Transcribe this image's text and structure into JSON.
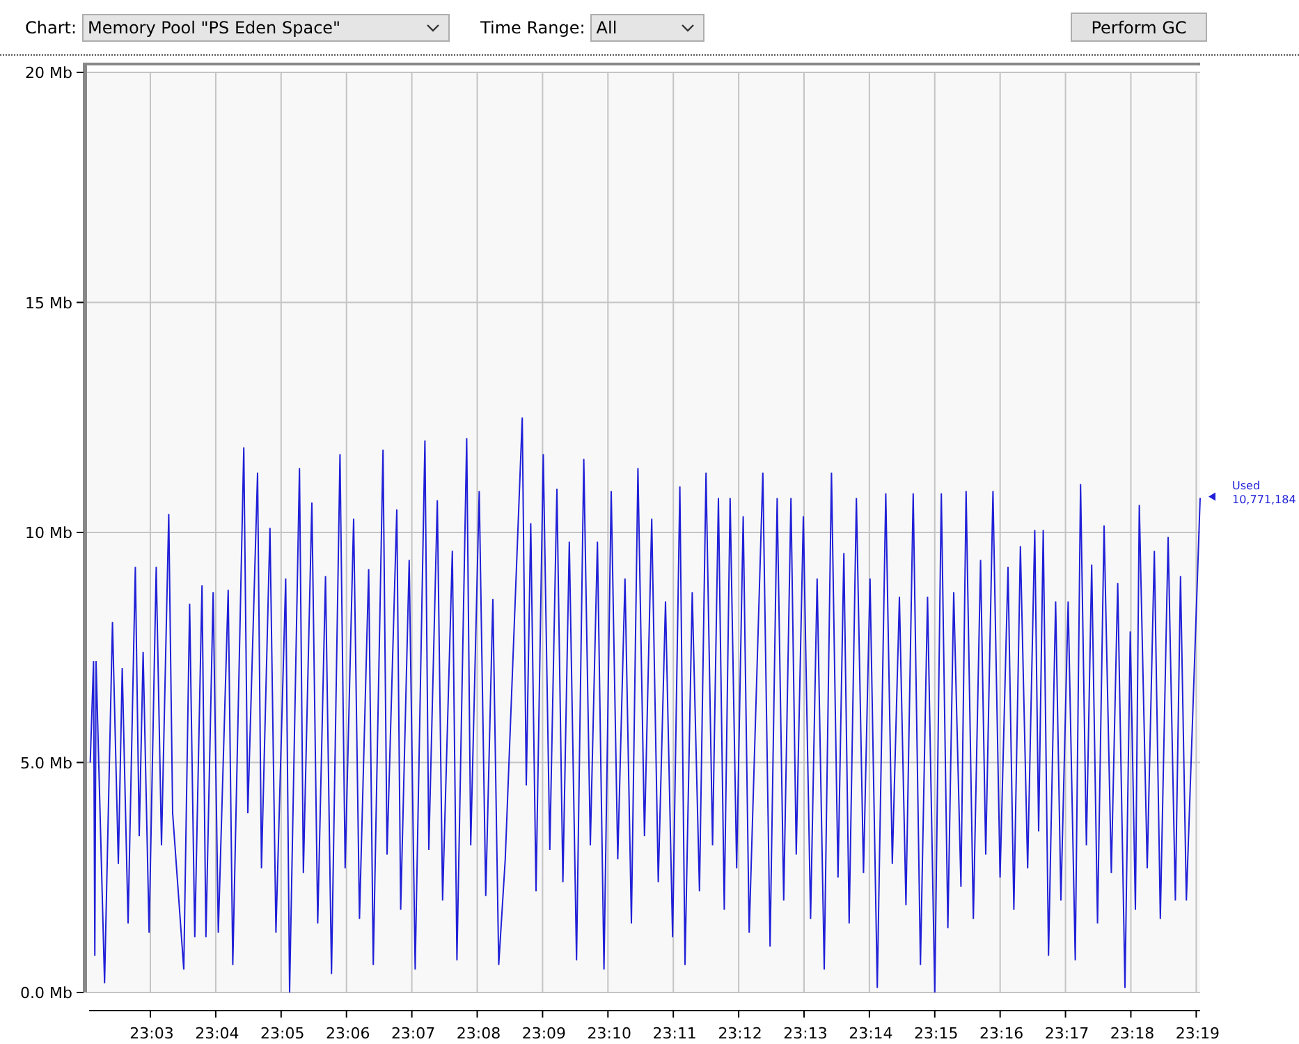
{
  "toolbar": {
    "chart_label": "Chart:",
    "chart_select": "Memory Pool \"PS Eden Space\"",
    "time_range_label": "Time Range:",
    "time_range_select": "All",
    "perform_gc": "Perform GC"
  },
  "memory_chart": {
    "current_value": "10,771,184",
    "chart_data": {
      "type": "line",
      "grid": true,
      "xlim": [
        1382.02,
        1399.06
      ],
      "ylim": [
        0,
        20
      ],
      "yticks": [
        {
          "value": 0,
          "label": "0.0 Mb"
        },
        {
          "value": 5,
          "label": "5.0 Mb"
        },
        {
          "value": 10,
          "label": "10 Mb"
        },
        {
          "value": 15,
          "label": "15 Mb"
        },
        {
          "value": 20,
          "label": "20 Mb"
        }
      ],
      "xticks": [
        {
          "value": 1383,
          "label": "23:03"
        },
        {
          "value": 1384,
          "label": "23:04"
        },
        {
          "value": 1385,
          "label": "23:05"
        },
        {
          "value": 1386,
          "label": "23:06"
        },
        {
          "value": 1387,
          "label": "23:07"
        },
        {
          "value": 1388,
          "label": "23:08"
        },
        {
          "value": 1389,
          "label": "23:09"
        },
        {
          "value": 1390,
          "label": "23:10"
        },
        {
          "value": 1391,
          "label": "23:11"
        },
        {
          "value": 1392,
          "label": "23:12"
        },
        {
          "value": 1393,
          "label": "23:13"
        },
        {
          "value": 1394,
          "label": "23:14"
        },
        {
          "value": 1395,
          "label": "23:15"
        },
        {
          "value": 1396,
          "label": "23:16"
        },
        {
          "value": 1397,
          "label": "23:17"
        },
        {
          "value": 1398,
          "label": "23:18"
        },
        {
          "value": 1399,
          "label": "23:19"
        }
      ],
      "x": [
        1382.08,
        1382.13,
        1382.15,
        1382.17,
        1382.3,
        1382.42,
        1382.51,
        1382.57,
        1382.66,
        1382.77,
        1382.83,
        1382.89,
        1382.98,
        1383.09,
        1383.17,
        1383.28,
        1383.34,
        1383.51,
        1383.6,
        1383.68,
        1383.79,
        1383.85,
        1383.96,
        1384.04,
        1384.19,
        1384.26,
        1384.43,
        1384.49,
        1384.64,
        1384.7,
        1384.83,
        1384.92,
        1385.07,
        1385.13,
        1385.28,
        1385.34,
        1385.47,
        1385.56,
        1385.68,
        1385.77,
        1385.9,
        1385.98,
        1386.11,
        1386.2,
        1386.34,
        1386.41,
        1386.56,
        1386.62,
        1386.77,
        1386.83,
        1386.96,
        1387.05,
        1387.2,
        1387.26,
        1387.39,
        1387.47,
        1387.62,
        1387.69,
        1387.84,
        1387.9,
        1388.03,
        1388.13,
        1388.24,
        1388.33,
        1388.43,
        1388.69,
        1388.75,
        1388.82,
        1388.9,
        1389.01,
        1389.11,
        1389.22,
        1389.31,
        1389.41,
        1389.52,
        1389.63,
        1389.73,
        1389.84,
        1389.94,
        1390.05,
        1390.15,
        1390.26,
        1390.36,
        1390.46,
        1390.56,
        1390.67,
        1390.77,
        1390.88,
        1390.99,
        1391.1,
        1391.18,
        1391.29,
        1391.4,
        1391.5,
        1391.6,
        1391.69,
        1391.78,
        1391.87,
        1391.97,
        1392.07,
        1392.16,
        1392.37,
        1392.48,
        1392.59,
        1392.69,
        1392.8,
        1392.88,
        1392.99,
        1393.1,
        1393.2,
        1393.31,
        1393.42,
        1393.52,
        1393.61,
        1393.69,
        1393.8,
        1393.91,
        1394.01,
        1394.12,
        1394.25,
        1394.35,
        1394.46,
        1394.56,
        1394.67,
        1394.78,
        1394.89,
        1395.0,
        1395.1,
        1395.2,
        1395.29,
        1395.4,
        1395.48,
        1395.59,
        1395.7,
        1395.78,
        1395.89,
        1396.0,
        1396.12,
        1396.21,
        1396.31,
        1396.42,
        1396.53,
        1396.59,
        1396.66,
        1396.74,
        1396.85,
        1396.93,
        1397.04,
        1397.15,
        1397.23,
        1397.32,
        1397.4,
        1397.49,
        1397.59,
        1397.7,
        1397.8,
        1397.91,
        1397.99,
        1398.07,
        1398.13,
        1398.25,
        1398.36,
        1398.45,
        1398.57,
        1398.68,
        1398.76,
        1398.85,
        1399.06
      ],
      "series": [
        {
          "name": "Used",
          "color": "#2020d8",
          "values": [
            5.0,
            7.2,
            0.8,
            7.2,
            0.2,
            8.05,
            2.8,
            7.05,
            1.5,
            9.25,
            3.4,
            7.4,
            1.3,
            9.25,
            3.2,
            10.4,
            3.9,
            0.5,
            8.45,
            1.2,
            8.85,
            1.2,
            8.7,
            1.3,
            8.75,
            0.6,
            11.85,
            3.9,
            11.3,
            2.7,
            10.1,
            1.3,
            9.0,
            0.0,
            11.4,
            2.6,
            10.65,
            1.5,
            9.05,
            0.4,
            11.7,
            2.7,
            10.3,
            1.6,
            9.2,
            0.6,
            11.8,
            3.0,
            10.5,
            1.8,
            9.4,
            0.5,
            12.0,
            3.1,
            10.7,
            2.0,
            9.6,
            0.7,
            12.05,
            3.2,
            10.9,
            2.1,
            8.55,
            0.6,
            2.9,
            12.5,
            4.5,
            10.2,
            2.2,
            11.7,
            3.1,
            10.95,
            2.4,
            9.8,
            0.7,
            11.6,
            3.2,
            9.8,
            0.5,
            10.9,
            2.9,
            9.0,
            1.5,
            11.4,
            3.4,
            10.3,
            2.4,
            8.5,
            1.2,
            11.0,
            0.6,
            8.7,
            2.2,
            11.3,
            3.2,
            10.75,
            1.8,
            10.75,
            2.7,
            10.35,
            1.3,
            11.3,
            1.0,
            10.75,
            2.0,
            10.75,
            3.0,
            10.35,
            1.6,
            9.0,
            0.5,
            11.3,
            2.5,
            9.55,
            1.5,
            10.75,
            2.6,
            9.0,
            0.1,
            10.85,
            2.8,
            8.6,
            1.9,
            10.85,
            0.6,
            8.6,
            0.0,
            10.85,
            1.4,
            8.7,
            2.3,
            10.9,
            1.6,
            9.4,
            3.0,
            10.9,
            2.5,
            9.25,
            1.8,
            9.7,
            2.7,
            10.05,
            3.5,
            10.05,
            0.8,
            8.5,
            2.0,
            8.5,
            0.7,
            11.05,
            3.2,
            9.3,
            1.5,
            10.15,
            2.6,
            8.9,
            0.1,
            7.85,
            1.8,
            10.6,
            2.7,
            9.6,
            1.6,
            9.9,
            2.0,
            9.05,
            2.0,
            10.75
          ]
        }
      ]
    }
  }
}
